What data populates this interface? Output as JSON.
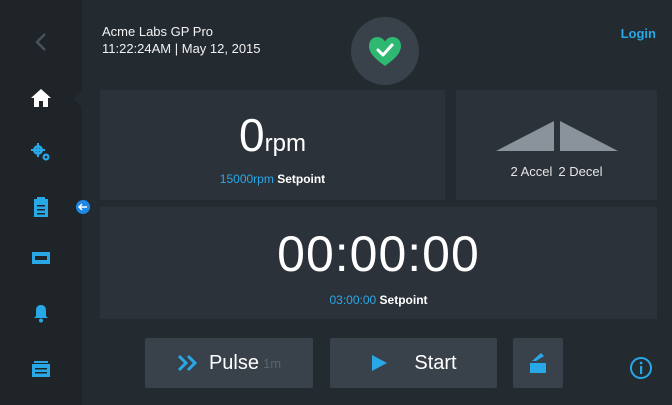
{
  "header": {
    "device_name": "Acme Labs GP Pro",
    "datetime": "11:22:24AM | May 12, 2015",
    "login_label": "Login"
  },
  "sidebar": {
    "items": [
      {
        "icon": "back-chevron-icon"
      },
      {
        "icon": "home-icon",
        "active": true
      },
      {
        "icon": "settings-gears-icon"
      },
      {
        "icon": "clipboard-icon"
      },
      {
        "icon": "tray-icon"
      },
      {
        "icon": "bell-icon"
      },
      {
        "icon": "folder-icon"
      }
    ]
  },
  "speed": {
    "value": "0",
    "unit": "rpm",
    "setpoint_value": "15000rpm",
    "setpoint_label": "Setpoint"
  },
  "ramp": {
    "accel_label": "2 Accel",
    "decel_label": "2 Decel"
  },
  "timer": {
    "value": "00:00:00",
    "setpoint_value": "03:00:00",
    "setpoint_label": "Setpoint"
  },
  "actions": {
    "pulse_label": "Pulse",
    "pulse_sub": "1m",
    "start_label": "Start"
  },
  "colors": {
    "accent": "#29a8e8",
    "status_ok": "#2eb872",
    "background": "#232a30",
    "panel": "#2b3239"
  }
}
